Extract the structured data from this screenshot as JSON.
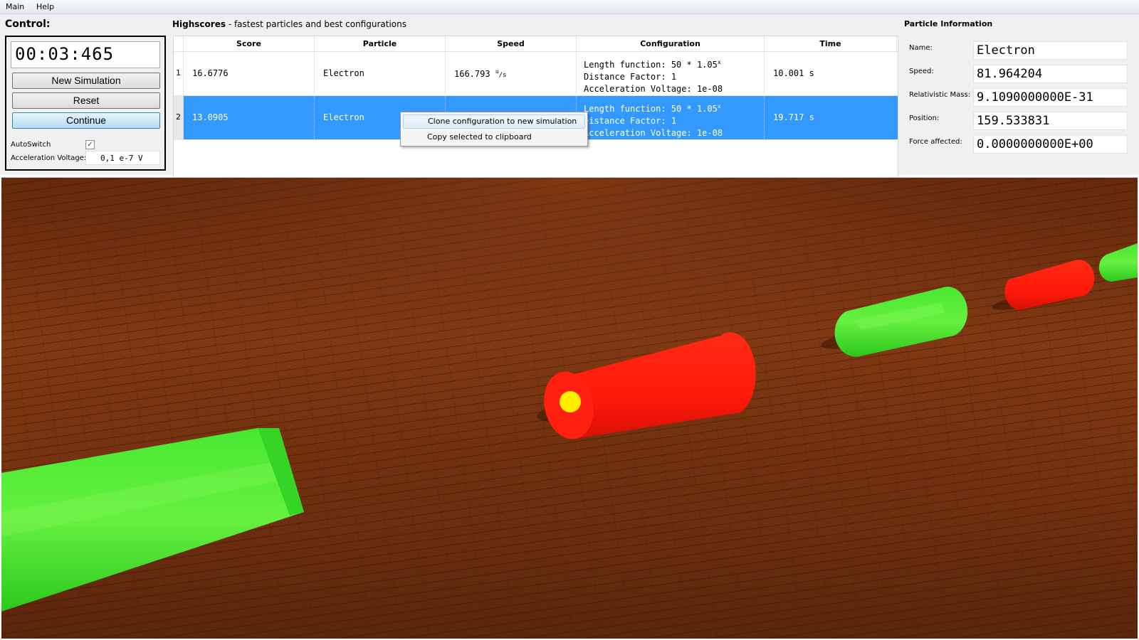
{
  "menu": {
    "items": [
      "Main",
      "Help"
    ]
  },
  "control": {
    "title": "Control:",
    "timer": "00:03:465",
    "new_simulation": "New Simulation",
    "reset": "Reset",
    "continue": "Continue",
    "autoswitch_label": "AutoSwitch",
    "autoswitch_checked": true,
    "voltage_label": "Acceleration Voltage:",
    "voltage_value": "0,1 e-7 V"
  },
  "highscores": {
    "title_bold": "Highscores",
    "title_rest": " - fastest particles and best configurations",
    "columns": [
      "Score",
      "Particle",
      "Speed",
      "Configuration",
      "Time"
    ],
    "rows": [
      {
        "index": "1",
        "score": "16.6776",
        "particle": "Electron",
        "speed": "166.793",
        "speed_unit_top": "u",
        "speed_unit_bottom": "/s",
        "config_line1": "Length function: 50 * 1.05",
        "config_exp": "x",
        "config_line2": "Distance Factor: 1",
        "config_line3": "Acceleration Voltage: 1e-08",
        "time": "10.001 s",
        "selected": false
      },
      {
        "index": "2",
        "score": "13.0905",
        "particle": "Electron",
        "speed": "",
        "config_line1": "Length function: 50 * 1.05",
        "config_exp": "x",
        "config_line2": "Distance Factor: 1",
        "config_line3": "Acceleration Voltage: 1e-08",
        "time": "19.717 s",
        "selected": true
      }
    ]
  },
  "context_menu": {
    "items": [
      "Clone configuration to new simulation",
      "Copy selected to clipboard"
    ]
  },
  "particle_info": {
    "title": "Particle Information",
    "fields": [
      {
        "label": "Name:",
        "value": "Electron"
      },
      {
        "label": "Speed:",
        "value": "81.964204"
      },
      {
        "label": "Relativistic Mass:",
        "value": "9.1090000000E-31"
      },
      {
        "label": "Position:",
        "value": "159.533831"
      },
      {
        "label": "Force affected:",
        "value": "0.0000000000E+00"
      }
    ]
  },
  "scene": {
    "tube_colors": {
      "green": "#3ee02a",
      "red": "#ff1a0a",
      "particle": "#ffee00"
    },
    "floor_color": "#7a3410"
  }
}
